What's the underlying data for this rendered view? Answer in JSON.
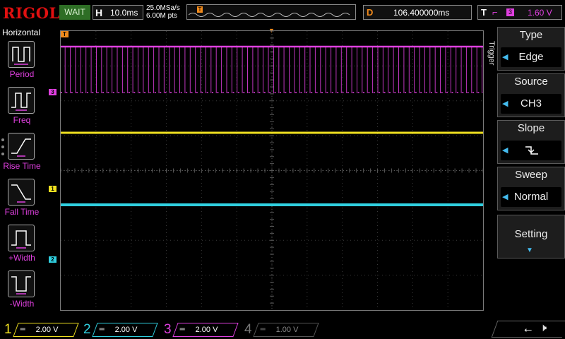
{
  "brand": "RIGOL",
  "run_status": "WAIT",
  "horizontal": {
    "label": "H",
    "timebase": "10.0ms",
    "sample_rate": "25.0MSa/s",
    "mem_depth": "6.00M pts"
  },
  "delay": {
    "label": "D",
    "value": "106.400000ms"
  },
  "trigger_status": {
    "label": "T",
    "channel": "3",
    "level": "1.60 V"
  },
  "left_menu": {
    "title": "Horizontal",
    "items": [
      {
        "label": "Period",
        "icon": "period-icon"
      },
      {
        "label": "Freq",
        "icon": "freq-icon"
      },
      {
        "label": "Rise Time",
        "icon": "rise-time-icon"
      },
      {
        "label": "Fall Time",
        "icon": "fall-time-icon"
      },
      {
        "label": "+Width",
        "icon": "positive-width-icon"
      },
      {
        "label": "-Width",
        "icon": "negative-width-icon"
      }
    ]
  },
  "right_menu": {
    "section": "Trigger",
    "items": [
      {
        "title": "Type",
        "value": "Edge"
      },
      {
        "title": "Source",
        "value": "CH3"
      },
      {
        "title": "Slope",
        "value": "falling-edge-icon"
      },
      {
        "title": "Sweep",
        "value": "Normal"
      }
    ],
    "setting_label": "Setting"
  },
  "channels": [
    {
      "num": "1",
      "scale": "2.00 V",
      "color": "#f0e020"
    },
    {
      "num": "2",
      "scale": "2.00 V",
      "color": "#30d0e0"
    },
    {
      "num": "3",
      "scale": "2.00 V",
      "color": "#e040e0"
    },
    {
      "num": "4",
      "scale": "1.00 V",
      "color": "#777777"
    }
  ],
  "markers": {
    "trigger": "T",
    "ch1": "1",
    "ch2": "2",
    "ch3": "3"
  }
}
